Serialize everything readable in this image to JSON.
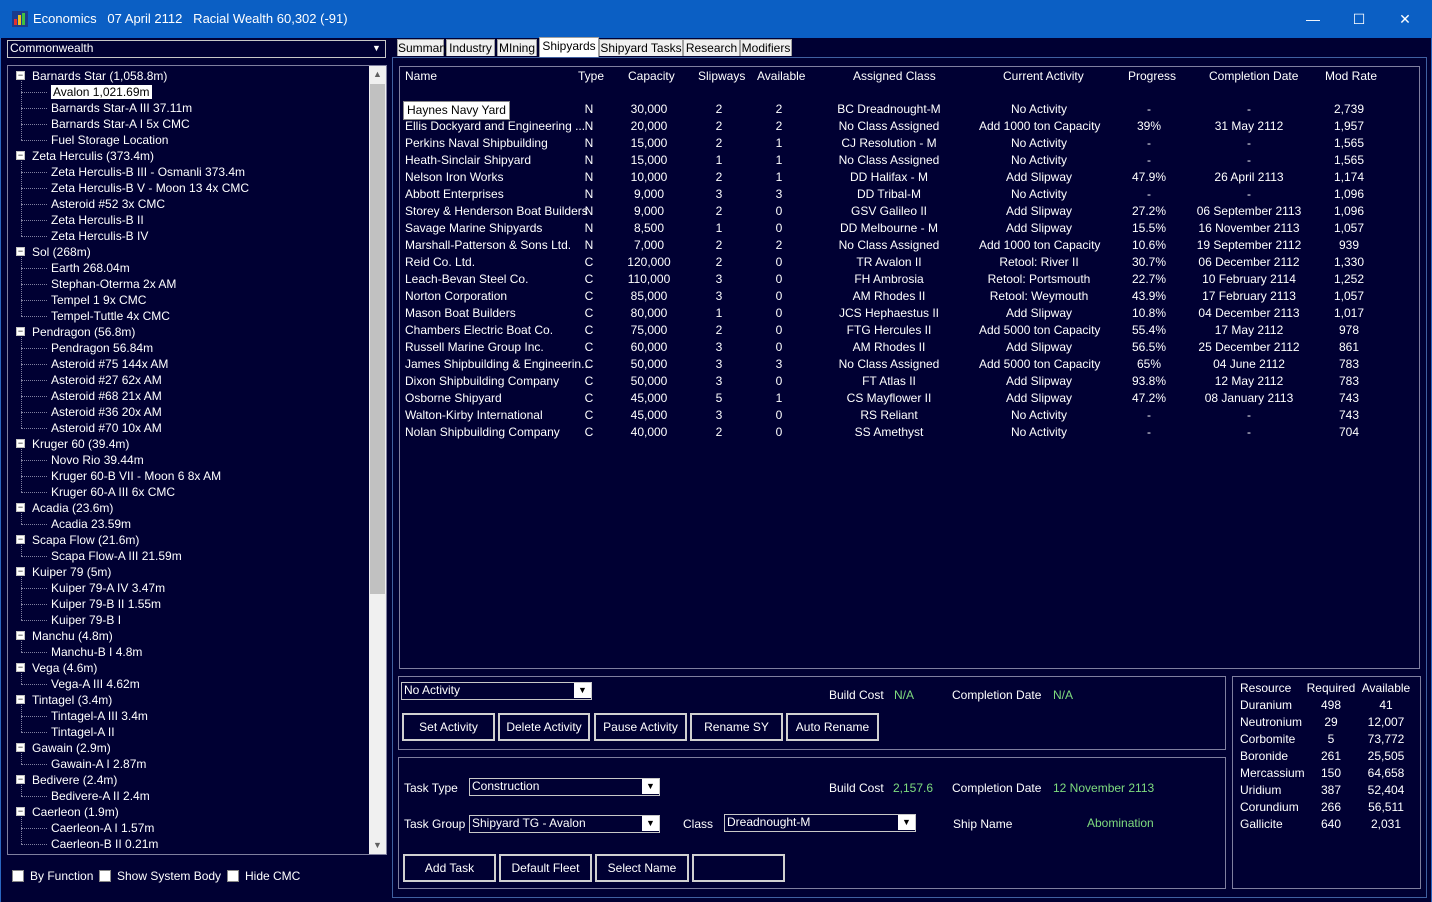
{
  "title": "Economics   07 April 2112   Racial Wealth 60,302 (-91)",
  "window_controls": {
    "minimize": "—",
    "maximize": "☐",
    "close": "✕"
  },
  "empire_select": "Commonwealth",
  "tree": [
    {
      "label": "Barnards Star  (1,058.8m)",
      "level": 0
    },
    {
      "label": "Avalon  1,021.69m",
      "level": 1,
      "selected": true
    },
    {
      "label": "Barnards Star-A III  37.11m",
      "level": 1
    },
    {
      "label": "Barnards Star-A I  5x CMC",
      "level": 1
    },
    {
      "label": "Fuel Storage Location",
      "level": 1
    },
    {
      "label": "Zeta Herculis  (373.4m)",
      "level": 0
    },
    {
      "label": "Zeta Herculis-B III - Osmanli  373.4m",
      "level": 1
    },
    {
      "label": "Zeta Herculis-B V - Moon 13  4x CMC",
      "level": 1
    },
    {
      "label": "Asteroid #52  3x CMC",
      "level": 1
    },
    {
      "label": "Zeta Herculis-B II",
      "level": 1
    },
    {
      "label": "Zeta Herculis-B IV",
      "level": 1
    },
    {
      "label": "Sol  (268m)",
      "level": 0
    },
    {
      "label": "Earth  268.04m",
      "level": 1
    },
    {
      "label": "Stephan-Oterma  2x AM",
      "level": 1
    },
    {
      "label": "Tempel 1  9x CMC",
      "level": 1
    },
    {
      "label": "Tempel-Tuttle  4x CMC",
      "level": 1
    },
    {
      "label": "Pendragon  (56.8m)",
      "level": 0
    },
    {
      "label": "Pendragon  56.84m",
      "level": 1
    },
    {
      "label": "Asteroid #75  144x AM",
      "level": 1
    },
    {
      "label": "Asteroid #27  62x AM",
      "level": 1
    },
    {
      "label": "Asteroid #68  21x AM",
      "level": 1
    },
    {
      "label": "Asteroid #36  20x AM",
      "level": 1
    },
    {
      "label": "Asteroid #70  10x AM",
      "level": 1
    },
    {
      "label": "Kruger 60  (39.4m)",
      "level": 0
    },
    {
      "label": "Novo Rio  39.44m",
      "level": 1
    },
    {
      "label": "Kruger 60-B VII - Moon 6  8x AM",
      "level": 1
    },
    {
      "label": "Kruger 60-A III  6x CMC",
      "level": 1
    },
    {
      "label": "Acadia  (23.6m)",
      "level": 0
    },
    {
      "label": "Acadia  23.59m",
      "level": 1
    },
    {
      "label": "Scapa Flow  (21.6m)",
      "level": 0
    },
    {
      "label": "Scapa Flow-A III  21.59m",
      "level": 1
    },
    {
      "label": "Kuiper 79  (5m)",
      "level": 0
    },
    {
      "label": "Kuiper 79-A IV  3.47m",
      "level": 1
    },
    {
      "label": "Kuiper 79-B II  1.55m",
      "level": 1
    },
    {
      "label": "Kuiper 79-B I",
      "level": 1
    },
    {
      "label": "Manchu  (4.8m)",
      "level": 0
    },
    {
      "label": "Manchu-B I  4.8m",
      "level": 1
    },
    {
      "label": "Vega  (4.6m)",
      "level": 0
    },
    {
      "label": "Vega-A III  4.62m",
      "level": 1
    },
    {
      "label": "Tintagel  (3.4m)",
      "level": 0
    },
    {
      "label": "Tintagel-A III  3.4m",
      "level": 1
    },
    {
      "label": "Tintagel-A II",
      "level": 1
    },
    {
      "label": "Gawain  (2.9m)",
      "level": 0
    },
    {
      "label": "Gawain-A I  2.87m",
      "level": 1
    },
    {
      "label": "Bedivere  (2.4m)",
      "level": 0
    },
    {
      "label": "Bedivere-A II  2.4m",
      "level": 1
    },
    {
      "label": "Caerleon  (1.9m)",
      "level": 0
    },
    {
      "label": "Caerleon-A I  1.57m",
      "level": 1
    },
    {
      "label": "Caerleon-B II  0.21m",
      "level": 1
    }
  ],
  "checkboxes": [
    "By Function",
    "Show System Body",
    "Hide CMC"
  ],
  "tabs": [
    "Summary",
    "Industry",
    "MIning",
    "Shipyards",
    "Shipyard Tasks",
    "Research",
    "Modifiers"
  ],
  "active_tab": "Shipyards",
  "columns": [
    "Name",
    "Type",
    "Capacity",
    "Slipways",
    "Available",
    "Assigned Class",
    "Current Activity",
    "Progress",
    "Completion Date",
    "Mod Rate"
  ],
  "shipyards": [
    [
      "Haynes Navy Yard",
      "N",
      "30,000",
      "2",
      "2",
      "BC Dreadnought-M",
      "No Activity",
      "-",
      "-",
      "2,739"
    ],
    [
      "Ellis Dockyard and Engineering ...",
      "N",
      "20,000",
      "2",
      "2",
      "No Class Assigned",
      "Add 1000 ton Capacity",
      "39%",
      "31 May 2112",
      "1,957"
    ],
    [
      "Perkins Naval Shipbuilding",
      "N",
      "15,000",
      "2",
      "1",
      "CJ Resolution - M",
      "No Activity",
      "-",
      "-",
      "1,565"
    ],
    [
      "Heath-Sinclair Shipyard",
      "N",
      "15,000",
      "1",
      "1",
      "No Class Assigned",
      "No Activity",
      "-",
      "-",
      "1,565"
    ],
    [
      "Nelson Iron Works",
      "N",
      "10,000",
      "2",
      "1",
      "DD Halifax - M",
      "Add Slipway",
      "47.9%",
      "26 April 2113",
      "1,174"
    ],
    [
      "Abbott Enterprises",
      "N",
      "9,000",
      "3",
      "3",
      "DD Tribal-M",
      "No Activity",
      "-",
      "-",
      "1,096"
    ],
    [
      "Storey & Henderson Boat Builders",
      "N",
      "9,000",
      "2",
      "0",
      "GSV Galileo II",
      "Add Slipway",
      "27.2%",
      "06 September 2113",
      "1,096"
    ],
    [
      "Savage Marine Shipyards",
      "N",
      "8,500",
      "1",
      "0",
      "DD Melbourne - M",
      "Add Slipway",
      "15.5%",
      "16 November 2113",
      "1,057"
    ],
    [
      "Marshall-Patterson & Sons Ltd.",
      "N",
      "7,000",
      "2",
      "2",
      "No Class Assigned",
      "Add 1000 ton Capacity",
      "10.6%",
      "19 September 2112",
      "939"
    ],
    [
      "Reid Co. Ltd.",
      "C",
      "120,000",
      "2",
      "0",
      "TR Avalon II",
      "Retool: River II",
      "30.7%",
      "06 December 2112",
      "1,330"
    ],
    [
      "Leach-Bevan Steel Co.",
      "C",
      "110,000",
      "3",
      "0",
      "FH Ambrosia",
      "Retool: Portsmouth",
      "22.7%",
      "10 February 2114",
      "1,252"
    ],
    [
      "Norton Corporation",
      "C",
      "85,000",
      "3",
      "0",
      "AM Rhodes II",
      "Retool: Weymouth",
      "43.9%",
      "17 February 2113",
      "1,057"
    ],
    [
      "Mason Boat Builders",
      "C",
      "80,000",
      "1",
      "0",
      "JCS Hephaestus II",
      "Add Slipway",
      "10.8%",
      "04 December 2113",
      "1,017"
    ],
    [
      "Chambers Electric Boat Co.",
      "C",
      "75,000",
      "2",
      "0",
      "FTG Hercules II",
      "Add 5000 ton Capacity",
      "55.4%",
      "17 May 2112",
      "978"
    ],
    [
      "Russell Marine Group Inc.",
      "C",
      "60,000",
      "3",
      "0",
      "AM Rhodes II",
      "Add Slipway",
      "56.5%",
      "25 December 2112",
      "861"
    ],
    [
      "James Shipbuilding & Engineerin...",
      "C",
      "50,000",
      "3",
      "3",
      "No Class Assigned",
      "Add 5000 ton Capacity",
      "65%",
      "04 June 2112",
      "783"
    ],
    [
      "Dixon Shipbuilding Company",
      "C",
      "50,000",
      "3",
      "0",
      "FT Atlas II",
      "Add Slipway",
      "93.8%",
      "12 May 2112",
      "783"
    ],
    [
      "Osborne Shipyard",
      "C",
      "45,000",
      "5",
      "1",
      "CS Mayflower II",
      "Add Slipway",
      "47.2%",
      "08 January 2113",
      "743"
    ],
    [
      "Walton-Kirby International",
      "C",
      "45,000",
      "3",
      "0",
      "RS Reliant",
      "No Activity",
      "-",
      "-",
      "743"
    ],
    [
      "Nolan Shipbuilding Company",
      "C",
      "40,000",
      "2",
      "0",
      "SS Amethyst",
      "No Activity",
      "-",
      "-",
      "704"
    ]
  ],
  "activity": {
    "select": "No Activity",
    "build_cost_label": "Build Cost",
    "build_cost": "N/A",
    "completion_label": "Completion Date",
    "completion": "N/A",
    "buttons": [
      "Set Activity",
      "Delete Activity",
      "Pause Activity",
      "Rename SY",
      "Auto Rename"
    ]
  },
  "task": {
    "task_type_label": "Task Type",
    "task_type": "Construction",
    "task_group_label": "Task Group",
    "task_group": "Shipyard TG - Avalon",
    "class_label": "Class",
    "class": "Dreadnought-M",
    "build_cost_label": "Build Cost",
    "build_cost": "2,157.6",
    "completion_label": "Completion Date",
    "completion": "12 November 2113",
    "ship_name_label": "Ship Name",
    "ship_name": "Abomination",
    "buttons": [
      "Add Task",
      "Default Fleet",
      "Select Name",
      ""
    ]
  },
  "resources": {
    "headers": [
      "Resource",
      "Required",
      "Available"
    ],
    "rows": [
      [
        "Duranium",
        "498",
        "41"
      ],
      [
        "Neutronium",
        "29",
        "12,007"
      ],
      [
        "Corbomite",
        "5",
        "73,772"
      ],
      [
        "Boronide",
        "261",
        "25,505"
      ],
      [
        "Mercassium",
        "150",
        "64,658"
      ],
      [
        "Uridium",
        "387",
        "52,404"
      ],
      [
        "Corundium",
        "266",
        "56,511"
      ],
      [
        "Gallicite",
        "640",
        "2,031"
      ]
    ]
  }
}
